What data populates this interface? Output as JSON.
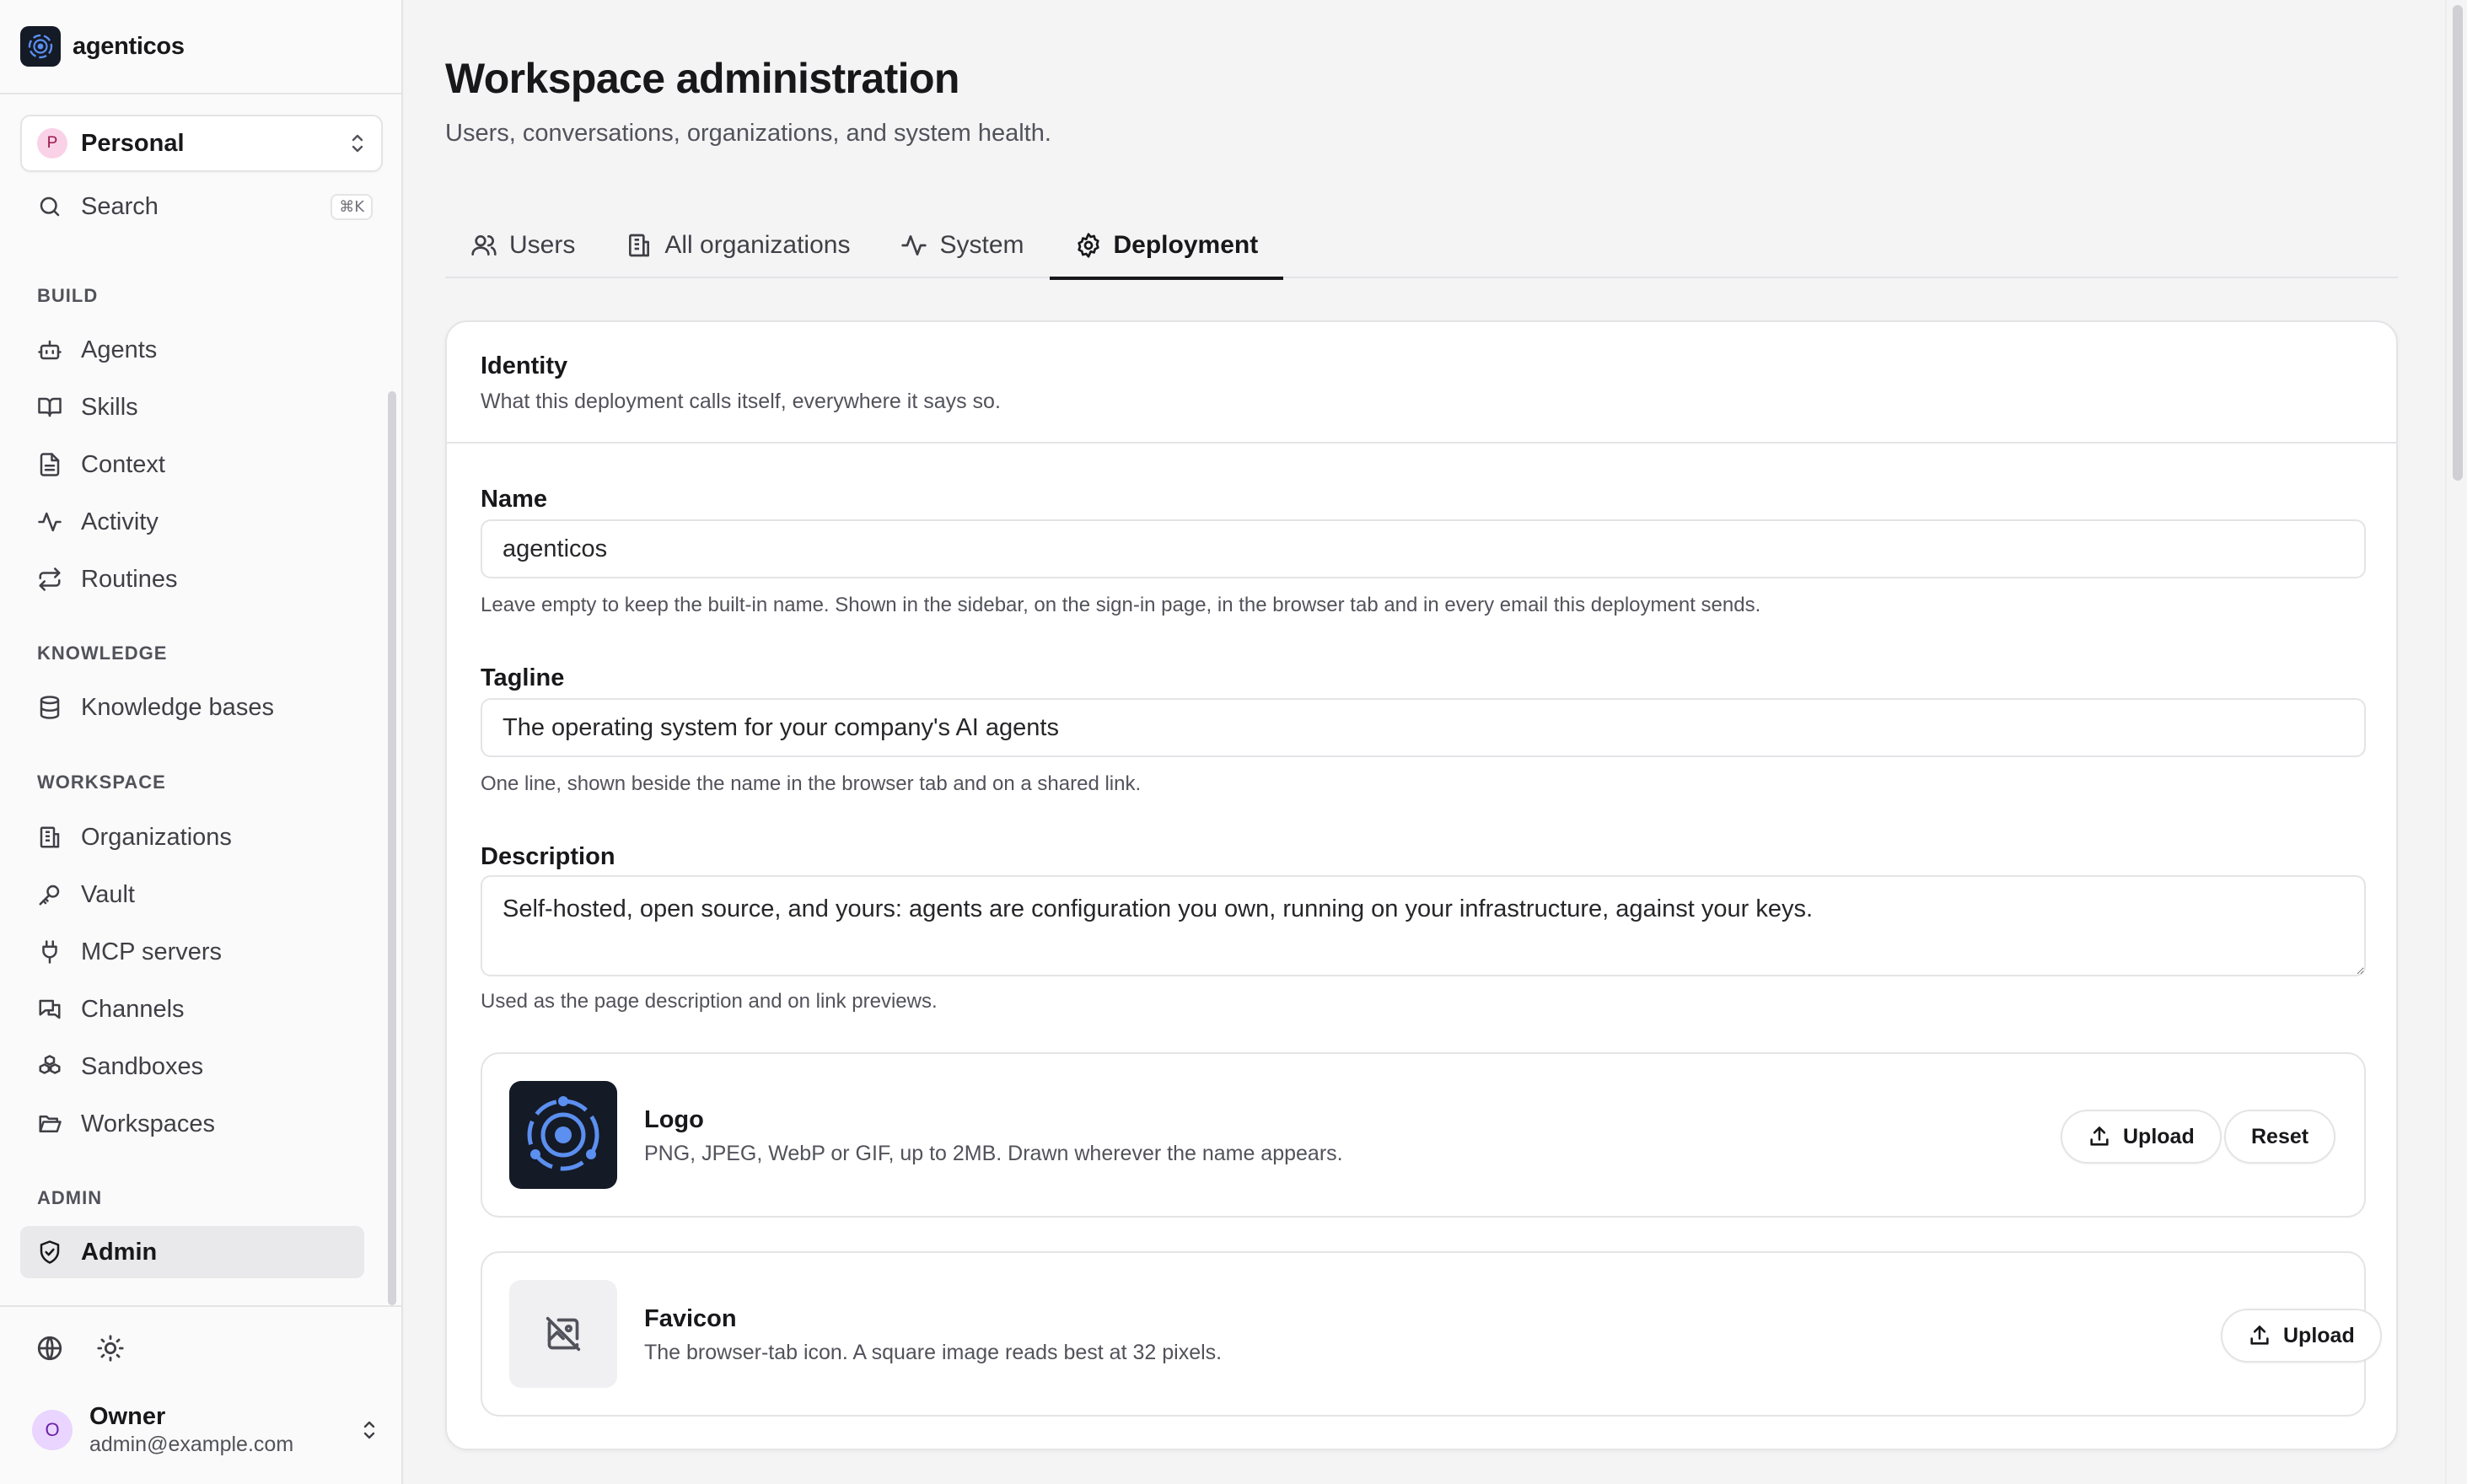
{
  "app": {
    "name": "agenticos"
  },
  "workspace_select": {
    "avatar": "P",
    "name": "Personal"
  },
  "search": {
    "label": "Search",
    "shortcut": "⌘K"
  },
  "sidebar": {
    "sections": {
      "build": "BUILD",
      "knowledge": "KNOWLEDGE",
      "workspace": "WORKSPACE",
      "admin": "ADMIN"
    },
    "items": {
      "agents": "Agents",
      "skills": "Skills",
      "context": "Context",
      "activity": "Activity",
      "routines": "Routines",
      "knowledge_bases": "Knowledge bases",
      "organizations": "Organizations",
      "vault": "Vault",
      "mcp_servers": "MCP servers",
      "channels": "Channels",
      "sandboxes": "Sandboxes",
      "workspaces": "Workspaces",
      "admin": "Admin"
    },
    "active": "admin"
  },
  "user": {
    "avatar": "O",
    "name": "Owner",
    "email": "admin@example.com"
  },
  "header": {
    "title": "Workspace administration",
    "subtitle": "Users, conversations, organizations, and system health."
  },
  "tabs": {
    "users": "Users",
    "all_organizations": "All organizations",
    "system": "System",
    "deployment": "Deployment",
    "active": "deployment"
  },
  "identity": {
    "title": "Identity",
    "subtitle": "What this deployment calls itself, everywhere it says so.",
    "name": {
      "label": "Name",
      "value": "agenticos",
      "help": "Leave empty to keep the built-in name. Shown in the sidebar, on the sign-in page, in the browser tab and in every email this deployment sends."
    },
    "tagline": {
      "label": "Tagline",
      "value": "The operating system for your company's AI agents",
      "help": "One line, shown beside the name in the browser tab and on a shared link."
    },
    "description": {
      "label": "Description",
      "value": "Self-hosted, open source, and yours: agents are configuration you own, running on your infrastructure, against your keys.",
      "help": "Used as the page description and on link previews."
    },
    "logo": {
      "title": "Logo",
      "subtitle": "PNG, JPEG, WebP or GIF, up to 2MB. Drawn wherever the name appears.",
      "upload_label": "Upload",
      "reset_label": "Reset"
    },
    "favicon": {
      "title": "Favicon",
      "subtitle": "The browser-tab icon. A square image reads best at 32 pixels.",
      "upload_label": "Upload"
    }
  },
  "colors": {
    "accent": "#18181b",
    "logo_bg": "#141a26",
    "logo_ring": "#5b8ff0"
  }
}
